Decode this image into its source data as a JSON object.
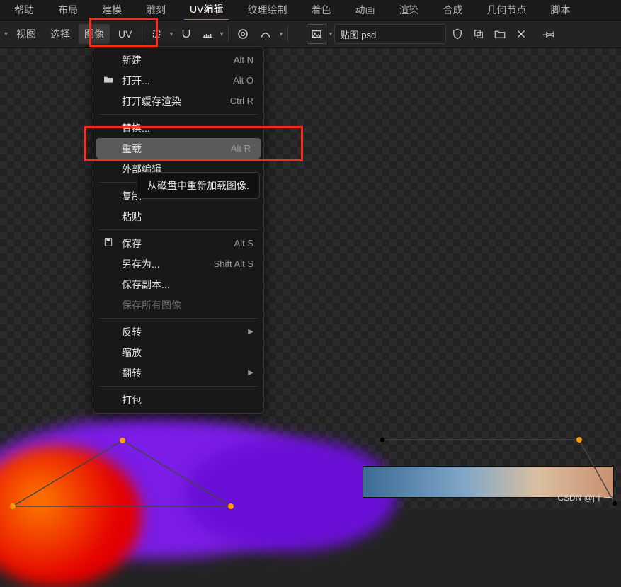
{
  "tabs": {
    "help": "帮助",
    "layout": "布局",
    "modeling": "建模",
    "sculpt": "雕刻",
    "uvedit": "UV编辑",
    "texpaint": "纹理绘制",
    "shading": "着色",
    "anim": "动画",
    "render": "渲染",
    "compose": "合成",
    "geonodes": "几何节点",
    "script": "脚本"
  },
  "toolbar": {
    "view": "视图",
    "select": "选择",
    "image": "图像",
    "uv": "UV",
    "filename": "贴图.psd"
  },
  "menu": {
    "new": {
      "label": "新建",
      "shortcut": "Alt N"
    },
    "open": {
      "label": "打开...",
      "shortcut": "Alt O"
    },
    "open_cached": {
      "label": "打开缓存渲染",
      "shortcut": "Ctrl R"
    },
    "replace": {
      "label": "替换..."
    },
    "reload": {
      "label": "重载",
      "shortcut": "Alt R"
    },
    "ext_edit": {
      "label": "外部编辑"
    },
    "copy": {
      "label": "复制"
    },
    "paste": {
      "label": "粘贴"
    },
    "save": {
      "label": "保存",
      "shortcut": "Alt S"
    },
    "saveas": {
      "label": "另存为...",
      "shortcut": "Shift Alt S"
    },
    "savecopy": {
      "label": "保存副本..."
    },
    "saveall": {
      "label": "保存所有图像"
    },
    "invert": {
      "label": "反转"
    },
    "scale": {
      "label": "缩放"
    },
    "flip": {
      "label": "翻转"
    },
    "pack": {
      "label": "打包"
    }
  },
  "tooltip": "从磁盘中重新加载图像.",
  "watermark": "CSDN @|十一|"
}
